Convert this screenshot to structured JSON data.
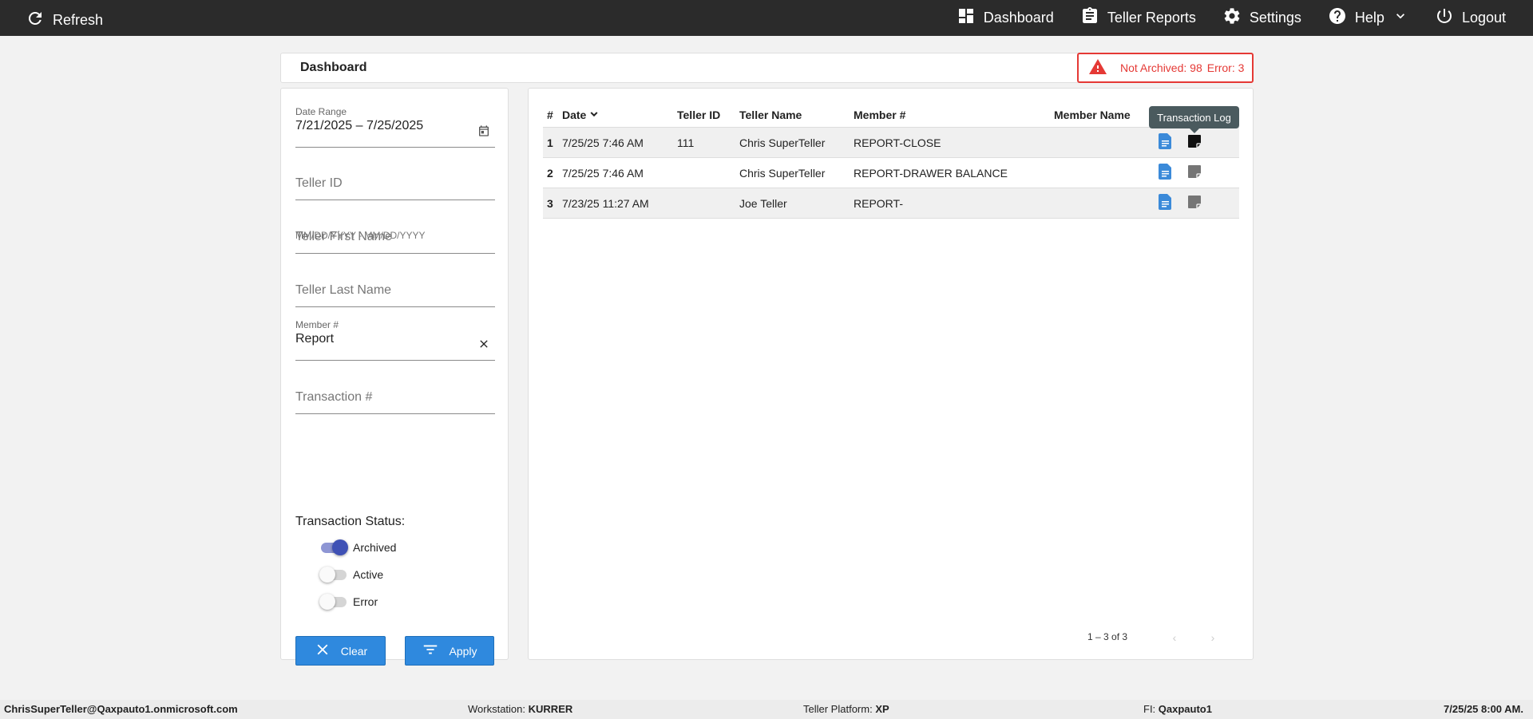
{
  "topbar": {
    "refresh_label": "Refresh",
    "nav": [
      {
        "label": "Dashboard",
        "icon": "dashboard-icon"
      },
      {
        "label": "Teller Reports",
        "icon": "clipboard-icon"
      },
      {
        "label": "Settings",
        "icon": "gear-icon"
      },
      {
        "label": "Help",
        "icon": "help-icon"
      },
      {
        "label": "Logout",
        "icon": "power-icon"
      }
    ],
    "bg_color": "#2b2b2b"
  },
  "page": {
    "title": "Dashboard",
    "alert": {
      "not_archived": "Not Archived: 98",
      "error": "Error: 3",
      "color": "#e53935"
    }
  },
  "filters": {
    "date_range": {
      "label": "Date Range",
      "value": "7/21/2025 – 7/25/2025",
      "hint": "MM/DD/YYYY - MM/DD/YYYY"
    },
    "teller_id": {
      "placeholder": "Teller ID"
    },
    "teller_first_name": {
      "placeholder": "Teller First Name"
    },
    "teller_last_name": {
      "placeholder": "Teller Last Name"
    },
    "member_number": {
      "label": "Member #",
      "value": "Report"
    },
    "transaction_number": {
      "placeholder": "Transaction #"
    },
    "status_title": "Transaction Status:",
    "statuses": [
      {
        "label": "Archived",
        "on": true
      },
      {
        "label": "Active",
        "on": false
      },
      {
        "label": "Error",
        "on": false
      }
    ],
    "clear_label": "Clear",
    "apply_label": "Apply",
    "button_color": "#2f89de"
  },
  "table": {
    "columns": [
      "#",
      "Date",
      "Teller ID",
      "Teller Name",
      "Member #",
      "Member Name"
    ],
    "rows": [
      {
        "idx": "1",
        "date": "7/25/25 7:46 AM",
        "teller_id": "111",
        "teller_name": "Chris SuperTeller",
        "member": "REPORT-CLOSE",
        "member_name": ""
      },
      {
        "idx": "2",
        "date": "7/25/25 7:46 AM",
        "teller_id": "",
        "teller_name": "Chris SuperTeller",
        "member": "REPORT-DRAWER BALANCE",
        "member_name": ""
      },
      {
        "idx": "3",
        "date": "7/23/25 11:27 AM",
        "teller_id": "",
        "teller_name": "Joe Teller",
        "member": "REPORT-",
        "member_name": ""
      }
    ],
    "tooltip": "Transaction Log",
    "pagination": "1 – 3 of 3"
  },
  "footer": {
    "user": "ChrisSuperTeller@Qaxpauto1.onmicrosoft.com",
    "workstation_label": "Workstation:",
    "workstation": "KURRER",
    "platform_label": "Teller Platform:",
    "platform": "XP",
    "fi_label": "FI:",
    "fi": "Qaxpauto1",
    "datetime": "7/25/25 8:00 AM."
  }
}
